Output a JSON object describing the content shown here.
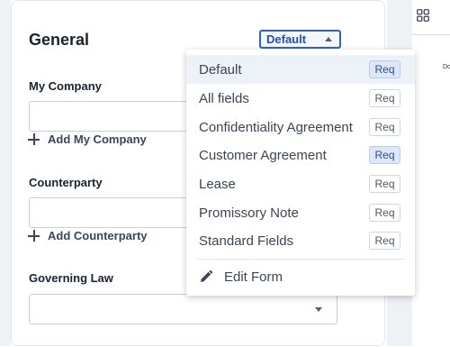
{
  "panel": {
    "title": "General",
    "preset_select_value": "Default",
    "my_company": {
      "label": "My Company",
      "add_label": "Add My Company"
    },
    "counterparty": {
      "label": "Counterparty",
      "add_label": "Add Counterparty"
    },
    "governing_law": {
      "label": "Governing Law",
      "value": ""
    }
  },
  "dropdown": {
    "options": [
      {
        "label": "Default",
        "req": "Req",
        "req_on": true,
        "active": true
      },
      {
        "label": "All fields",
        "req": "Req",
        "req_on": false,
        "active": false
      },
      {
        "label": "Confidentiality Agreement",
        "req": "Req",
        "req_on": false,
        "active": false
      },
      {
        "label": "Customer Agreement",
        "req": "Req",
        "req_on": true,
        "active": false
      },
      {
        "label": "Lease",
        "req": "Req",
        "req_on": false,
        "active": false
      },
      {
        "label": "Promissory Note",
        "req": "Req",
        "req_on": false,
        "active": false
      },
      {
        "label": "Standard Fields",
        "req": "Req",
        "req_on": false,
        "active": false
      }
    ],
    "edit_form_label": "Edit Form"
  },
  "right_strip": {
    "mini_text": "Do"
  },
  "icons": {
    "grid": "grid-icon",
    "plus": "plus-icon",
    "pencil": "pencil-icon",
    "caret": "chevron-down-icon"
  }
}
